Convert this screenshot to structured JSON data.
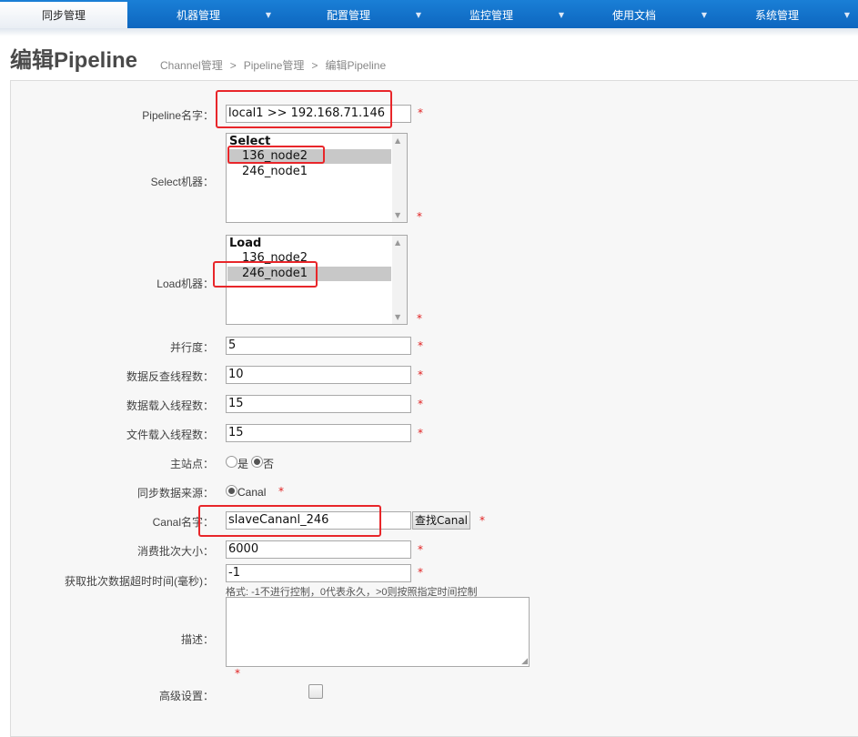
{
  "nav": {
    "items": [
      {
        "label": "同步管理",
        "active": true
      },
      {
        "label": "机器管理",
        "active": false
      },
      {
        "label": "配置管理",
        "active": false
      },
      {
        "label": "监控管理",
        "active": false
      },
      {
        "label": "使用文档",
        "active": false
      },
      {
        "label": "系统管理",
        "active": false
      }
    ],
    "caret": "▼"
  },
  "page": {
    "title": "编辑Pipeline",
    "breadcrumb": [
      "Channel管理",
      "Pipeline管理",
      "编辑Pipeline"
    ],
    "breadcrumb_sep": ">"
  },
  "form": {
    "pipeline_name": {
      "label": "Pipeline名字：",
      "value": "local1 >> 192.168.71.146"
    },
    "select_machine": {
      "label": "Select机器：",
      "group": "Select",
      "options": [
        "136_node2",
        "246_node1"
      ],
      "selected": "136_node2"
    },
    "load_machine": {
      "label": "Load机器：",
      "group": "Load",
      "options": [
        "136_node2",
        "246_node1"
      ],
      "selected": "246_node1"
    },
    "parallelism": {
      "label": "并行度：",
      "value": "5"
    },
    "extract_threads": {
      "label": "数据反查线程数：",
      "value": "10"
    },
    "load_threads": {
      "label": "数据载入线程数：",
      "value": "15"
    },
    "file_load_threads": {
      "label": "文件载入线程数：",
      "value": "15"
    },
    "main_site": {
      "label": "主站点：",
      "options": [
        "是",
        "否"
      ],
      "selected": "否"
    },
    "data_source": {
      "label": "同步数据来源：",
      "option": "Canal"
    },
    "canal_name": {
      "label": "Canal名字：",
      "value": "slaveCananl_246",
      "button": "查找Canal"
    },
    "batch_size": {
      "label": "消费批次大小：",
      "value": "6000"
    },
    "batch_timeout": {
      "label": "获取批次数据超时时间(毫秒)：",
      "value": "-1",
      "hint": "格式: -1不进行控制，0代表永久，>0则按照指定时间控制"
    },
    "description": {
      "label": "描述：",
      "value": ""
    },
    "advanced": {
      "label": "高级设置：",
      "checked": false
    },
    "required_mark": "*"
  },
  "colors": {
    "nav_bg": "#1173cc",
    "highlight": "#e8262a",
    "required": "#e02020"
  }
}
